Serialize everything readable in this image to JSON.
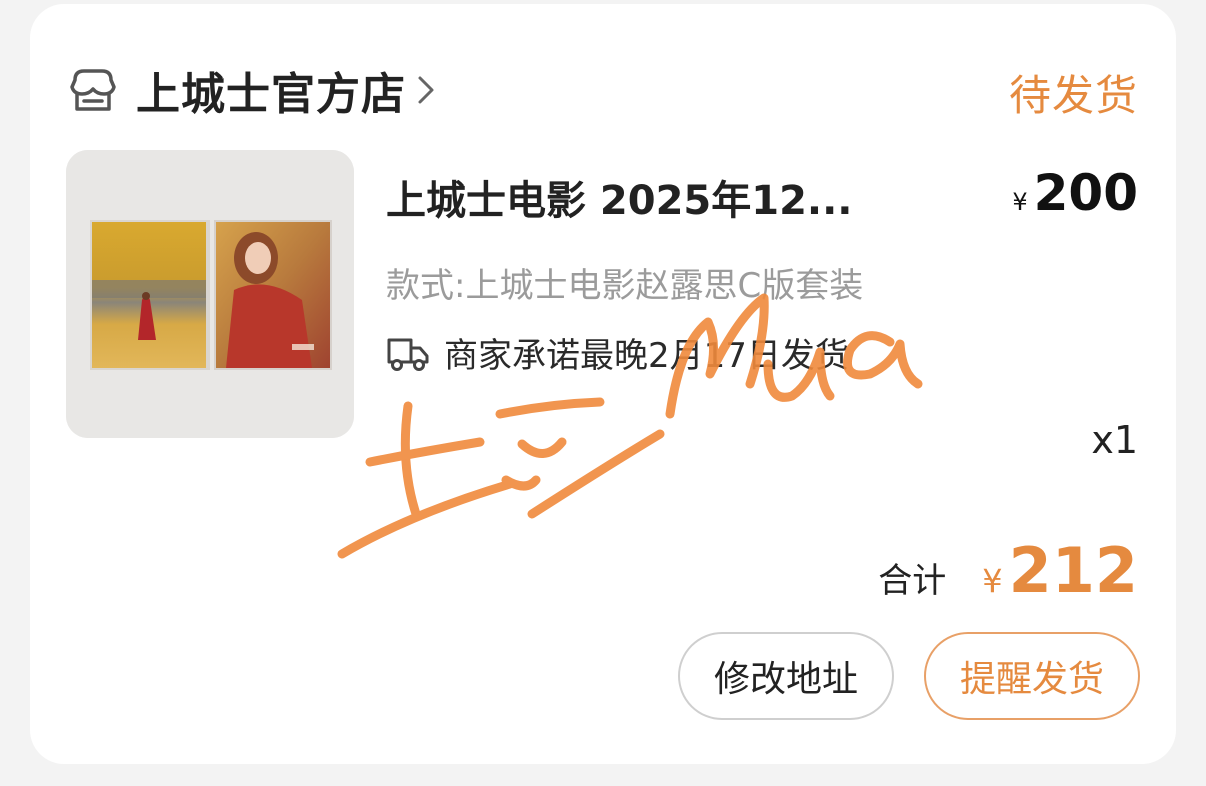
{
  "shop": {
    "name": "上城士官方店",
    "status": "待发货"
  },
  "product": {
    "title": "上城士电影 2025年12...",
    "price_currency": "¥",
    "price": "200",
    "spec": "款式:上城士电影赵露思C版套装",
    "promise": "商家承诺最晚2月17日发货",
    "quantity": "x1"
  },
  "summary": {
    "label": "合计",
    "currency": "¥",
    "amount": "212"
  },
  "actions": {
    "modify_address": "修改地址",
    "remind_shipping": "提醒发货"
  },
  "watermark": {
    "text": "土豆Mua"
  },
  "colors": {
    "accent": "#e58a3f",
    "watermark": "#f08a3c"
  },
  "icons": {
    "shop": "shop-icon",
    "chevron": "chevron-right-icon",
    "truck": "truck-icon"
  }
}
